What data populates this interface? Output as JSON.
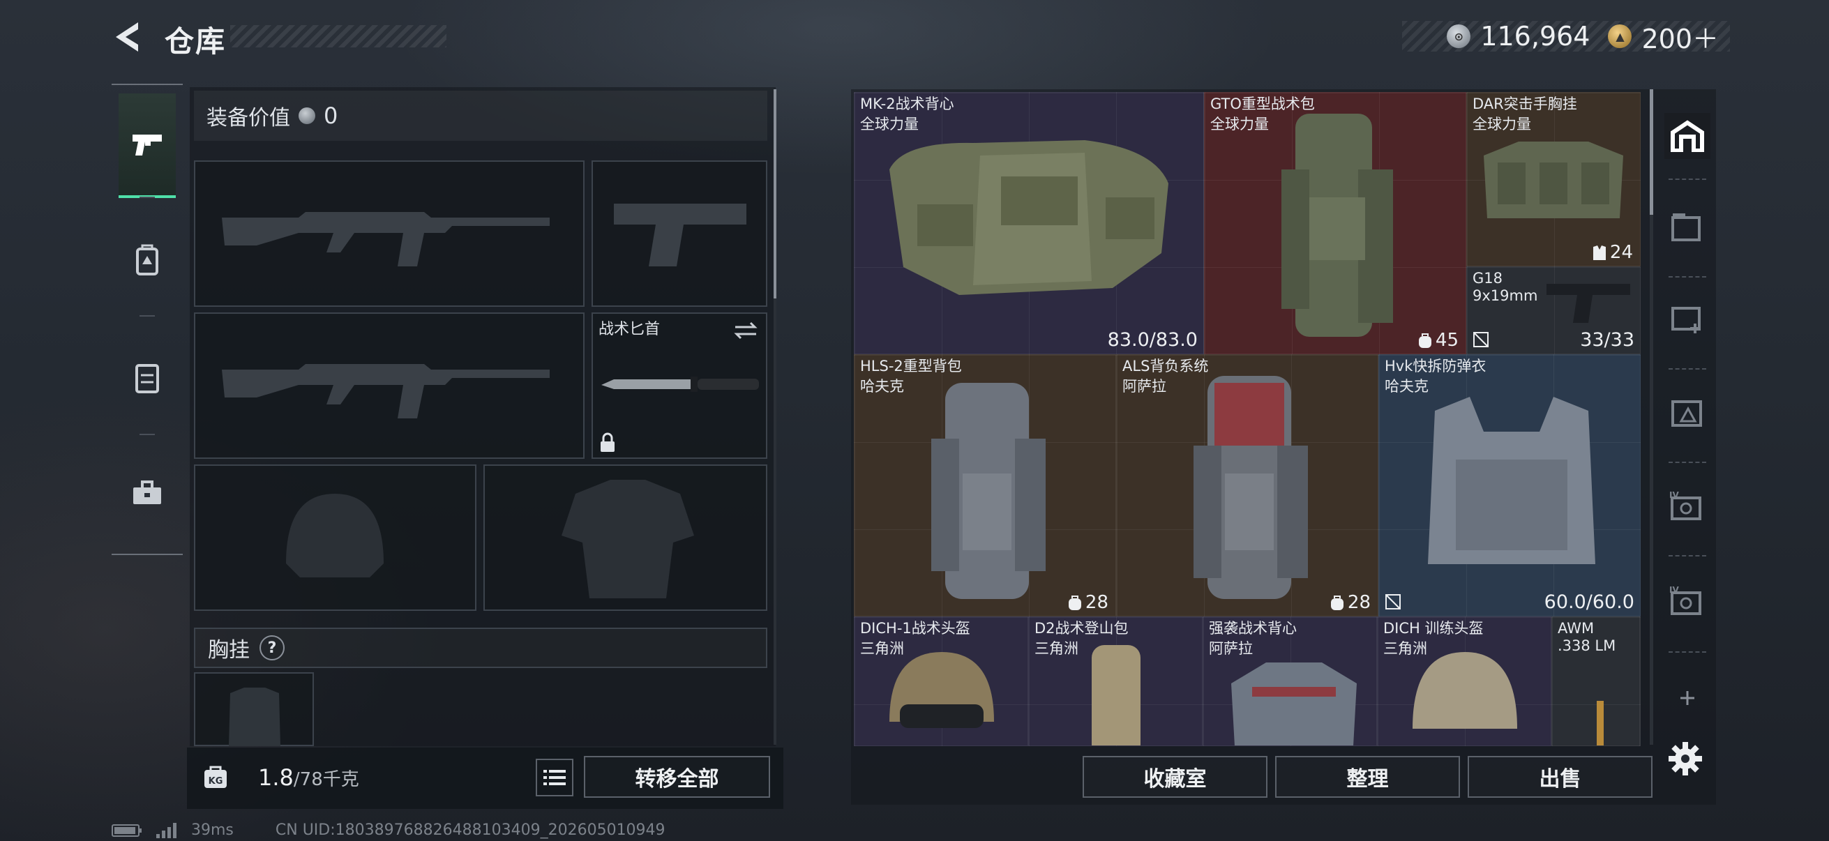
{
  "header": {
    "title": "仓库"
  },
  "currency": {
    "silver": "116,964",
    "gold": "200＋"
  },
  "equipment": {
    "value_label": "装备价值",
    "value": "0",
    "knife_slot_label": "战术匕首",
    "chest_rig_label": "胸挂",
    "help_mark": "?",
    "weight_value": "1.8",
    "weight_max": "/78千克",
    "transfer_all": "转移全部"
  },
  "inventory": {
    "items": [
      {
        "name": "MK-2战术背心",
        "maker": "全球力量",
        "durability": "83.0/83.0"
      },
      {
        "name": "GTO重型战术包",
        "maker": "全球力量",
        "capacity": "45"
      },
      {
        "name": "DAR突击手胸挂",
        "maker": "全球力量",
        "capacity": "24"
      },
      {
        "name": "G18",
        "maker": "9x19mm",
        "ammo": "33/33"
      },
      {
        "name": "HLS-2重型背包",
        "maker": "哈夫克",
        "capacity": "28"
      },
      {
        "name": "ALS背负系统",
        "maker": "阿萨拉",
        "capacity": "28"
      },
      {
        "name": "Hvk快拆防弹衣",
        "maker": "哈夫克",
        "durability": "60.0/60.0"
      },
      {
        "name": "DICH-1战术头盔",
        "maker": "三角洲"
      },
      {
        "name": "D2战术登山包",
        "maker": "三角洲"
      },
      {
        "name": "强袭战术背心",
        "maker": "阿萨拉"
      },
      {
        "name": "DICH 训练头盔",
        "maker": "三角洲"
      },
      {
        "name": "AWM",
        "maker": ".338 LM"
      }
    ]
  },
  "buttons": {
    "collection": "收藏室",
    "sort": "整理",
    "sell": "出售"
  },
  "status": {
    "ping": "39ms",
    "uid": "CN UID:180389768826488103409_202605010949"
  },
  "colors": {
    "accent": "#4fe0a9",
    "rarity_purple": "#2d2a41",
    "rarity_red": "#4c2427",
    "rarity_brown": "#3c3127",
    "rarity_blue": "#2b3a4d"
  },
  "icons": [
    "back-arrow-icon",
    "silver-coin-icon",
    "gold-coin-icon",
    "pistol-icon",
    "backpack-icon",
    "vest-icon",
    "toolbox-icon",
    "lock-icon",
    "swap-icon",
    "weight-icon",
    "list-icon",
    "warehouse-icon",
    "settings-gear-icon",
    "plus-icon"
  ]
}
